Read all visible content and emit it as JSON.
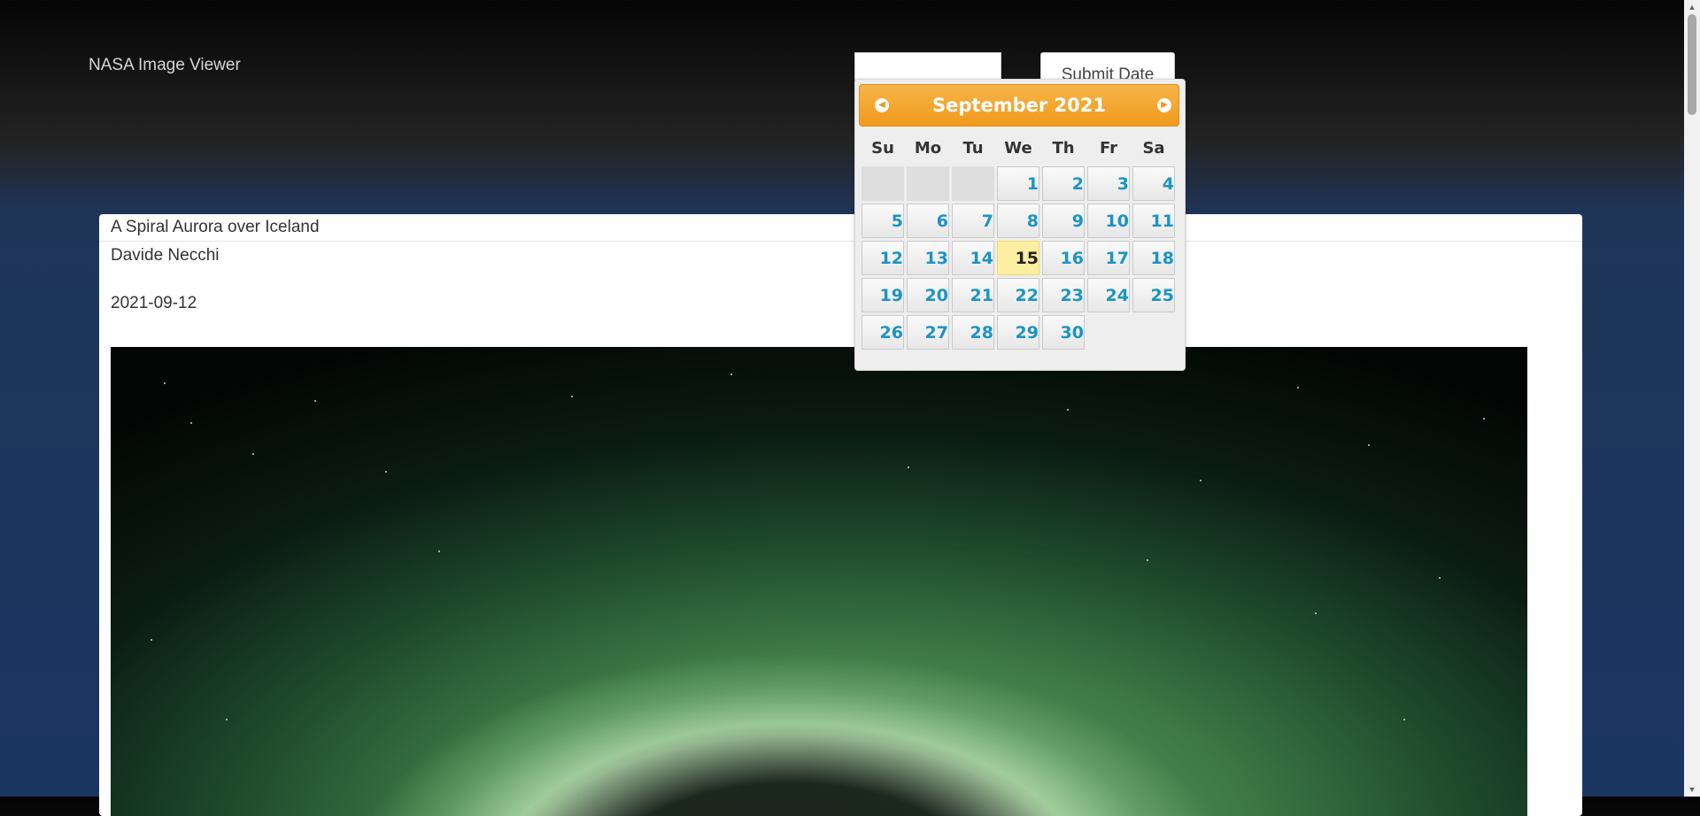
{
  "nav": {
    "brand": "NASA Image Viewer"
  },
  "date_form": {
    "input_value": "",
    "submit_label": "Submit Date"
  },
  "datepicker": {
    "month_year": "September 2021",
    "prev_icon": "circle-triangle-w",
    "next_icon": "circle-triangle-e",
    "weekdays": [
      "Su",
      "Mo",
      "Tu",
      "We",
      "Th",
      "Fr",
      "Sa"
    ],
    "weeks": [
      [
        "",
        "",
        "",
        "1",
        "2",
        "3",
        "4"
      ],
      [
        "5",
        "6",
        "7",
        "8",
        "9",
        "10",
        "11"
      ],
      [
        "12",
        "13",
        "14",
        "15",
        "16",
        "17",
        "18"
      ],
      [
        "19",
        "20",
        "21",
        "22",
        "23",
        "24",
        "25"
      ],
      [
        "26",
        "27",
        "28",
        "29",
        "30",
        "",
        ""
      ]
    ],
    "today": "15",
    "header_color": "#f09a1c",
    "day_color": "#1c94c4",
    "today_bg": "#fdeea1"
  },
  "apod": {
    "title": "A Spiral Aurora over Iceland",
    "author": "Davide Necchi",
    "date": "2021-09-12"
  },
  "colors": {
    "page_background": "#1b3563",
    "header_background": "#232323"
  }
}
